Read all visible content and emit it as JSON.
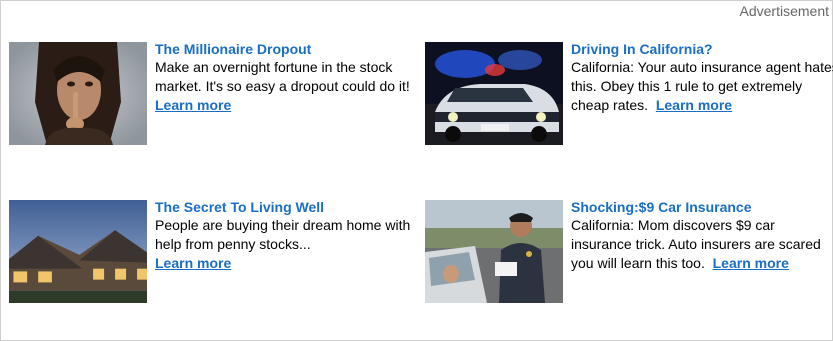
{
  "header": {
    "advertisement_label": "Advertisement"
  },
  "ads": [
    {
      "title": "The Millionaire Dropout",
      "body": "Make an overnight fortune in the stock market. It's so easy a dropout could do it!",
      "cta": "Learn more",
      "image": "man-shushing-photo"
    },
    {
      "title": "Driving In California?",
      "body": "California: Your auto insurance agent hates this. Obey this 1 rule to get extremely cheap rates.",
      "cta": "Learn more",
      "image": "police-car-night-photo"
    },
    {
      "title": "The Secret To Living Well",
      "body": "People are buying their dream home with help from penny stocks...",
      "cta": "Learn more",
      "image": "mansion-dusk-photo"
    },
    {
      "title": "Shocking:$9 Car Insurance",
      "body": "California: Mom discovers $9 car insurance trick. Auto insurers are scared you will learn this too.",
      "cta": "Learn more",
      "image": "traffic-stop-photo"
    }
  ],
  "colors": {
    "link": "#1a6fc4",
    "border": "#cfcfcf",
    "label": "#666666"
  }
}
